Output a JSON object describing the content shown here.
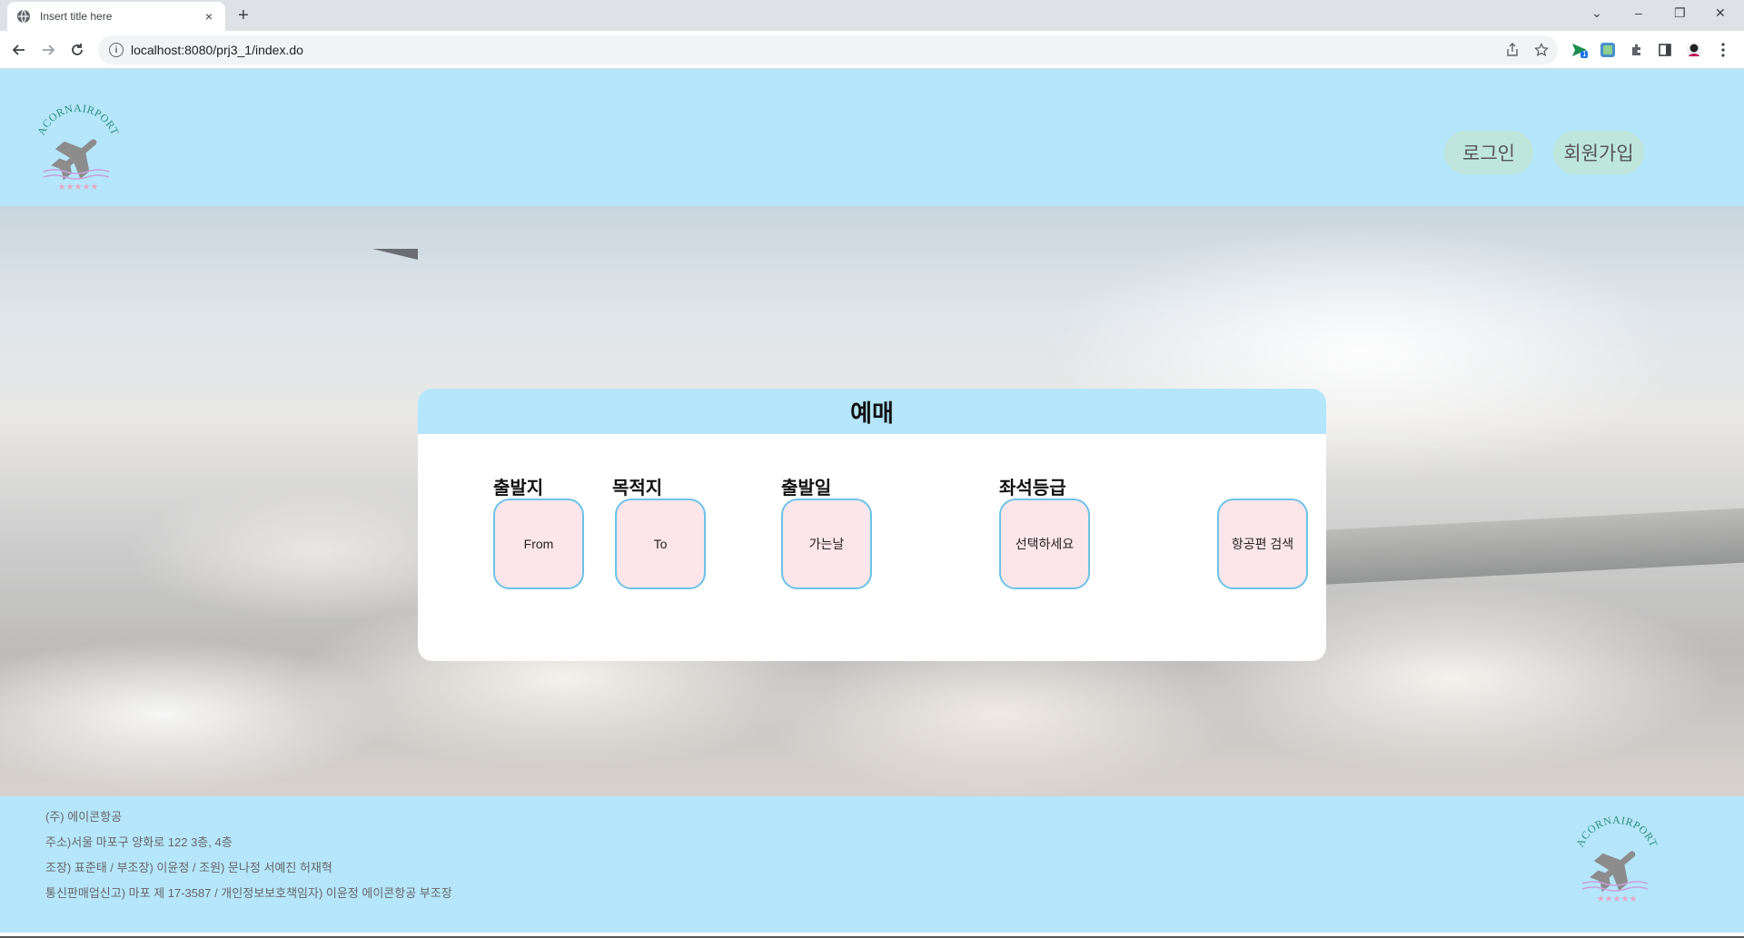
{
  "browser": {
    "tab_title": "Insert title here",
    "tab_close": "×",
    "new_tab": "+",
    "url": "localhost:8080/prj3_1/index.do",
    "info_glyph": "i",
    "window_controls": {
      "dropdown": "⌄",
      "minimize": "–",
      "restore": "❐",
      "close": "✕"
    },
    "extension_badge": "1"
  },
  "header": {
    "logo_text": "ACORNAIRPORT",
    "login_label": "로그인",
    "signup_label": "회원가입"
  },
  "booking": {
    "title": "예매",
    "origin_label": "출발지",
    "origin_value": "From",
    "destination_label": "목적지",
    "destination_value": "To",
    "departure_label": "출발일",
    "departure_value": "가는날",
    "seat_label": "좌석등급",
    "seat_value": "선택하세요",
    "search_label": "항공편 검색"
  },
  "footer": {
    "company": "(주) 에이콘항공",
    "address": "주소)서울 마포구 양화로 122 3층, 4층",
    "team": "조장) 표준태 / 부조장) 이윤정 / 조원) 문나정 서예진 허재혁",
    "registration": "통신판매업신고) 마포 제 17-3587 / 개인정보보호책임자) 이윤정 에이콘항공 부조장",
    "logo_text": "ACORNAIRPORT"
  },
  "colors": {
    "header_bg": "#b5e6fb",
    "pill_bg": "#bfe6dc",
    "field_bg": "#fde6ea",
    "field_border": "#6cc3e8"
  },
  "icons": [
    "globe-icon",
    "back-icon",
    "forward-icon",
    "reload-icon",
    "info-icon",
    "share-icon",
    "bookmark-star-icon",
    "extension-send-icon",
    "extension-translate-icon",
    "puzzle-icon",
    "sidepanel-icon",
    "profile-icon",
    "menu-icon",
    "plane-icon"
  ]
}
